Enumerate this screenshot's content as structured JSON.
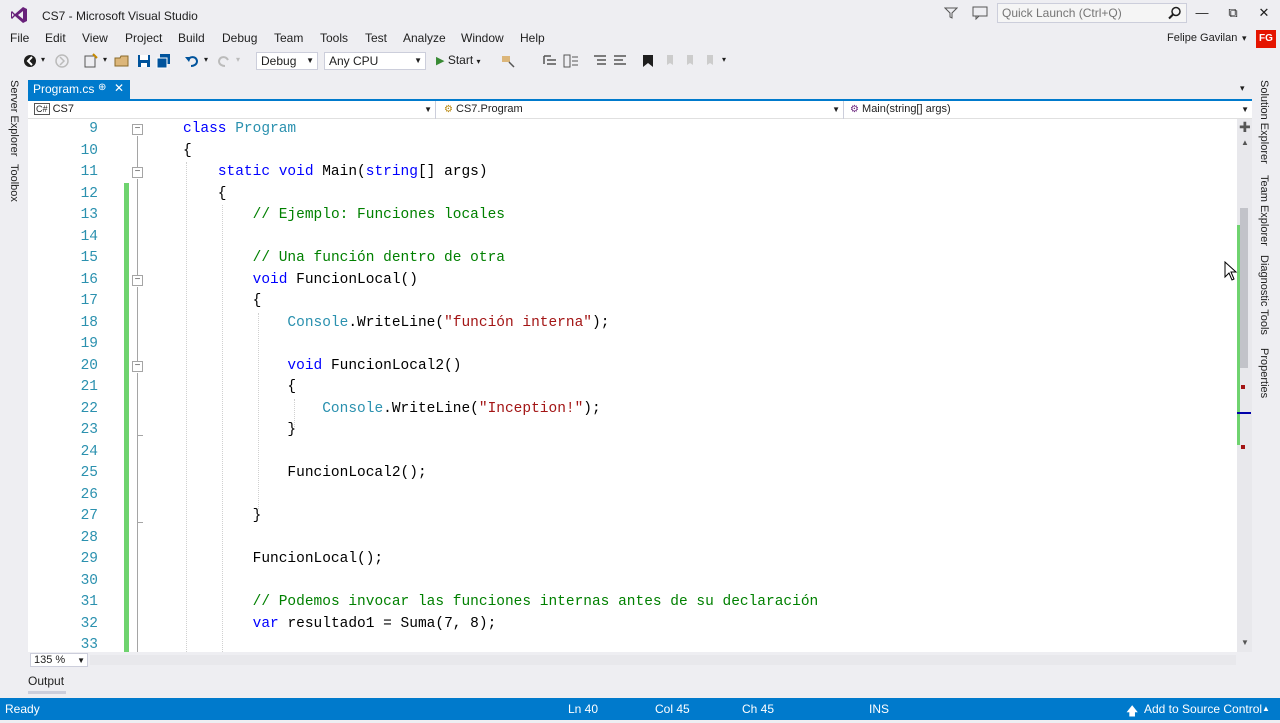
{
  "window": {
    "title": "CS7 - Microsoft Visual Studio",
    "quick_launch_placeholder": "Quick Launch (Ctrl+Q)",
    "user_name": "Felipe Gavilan",
    "user_initials": "FG",
    "minimize": "—",
    "maximize": "⧉",
    "close": "✕"
  },
  "menu": [
    "File",
    "Edit",
    "View",
    "Project",
    "Build",
    "Debug",
    "Team",
    "Tools",
    "Test",
    "Analyze",
    "Window",
    "Help"
  ],
  "toolbar": {
    "configuration": "Debug",
    "platform": "Any CPU",
    "start_label": "Start"
  },
  "left_tools": [
    "Server Explorer",
    "Toolbox"
  ],
  "right_tools": [
    "Solution Explorer",
    "Team Explorer",
    "Diagnostic Tools",
    "Properties"
  ],
  "document_tab": {
    "label": "Program.cs",
    "pin": "⊕",
    "close": "✕"
  },
  "navigation": {
    "project": "CS7",
    "type": "CS7.Program",
    "member": "Main(string[] args)"
  },
  "editor": {
    "line_numbers": [
      "9",
      "10",
      "11",
      "12",
      "13",
      "14",
      "15",
      "16",
      "17",
      "18",
      "19",
      "20",
      "21",
      "22",
      "23",
      "24",
      "25",
      "26",
      "27",
      "28",
      "29",
      "30",
      "31",
      "32",
      "33"
    ],
    "lines": [
      [
        {
          "c": "kw",
          "t": "class "
        },
        {
          "c": "ty",
          "t": "Program"
        }
      ],
      [
        {
          "c": "tx",
          "t": "{"
        }
      ],
      [
        {
          "c": "tx",
          "t": "    "
        },
        {
          "c": "kw",
          "t": "static void "
        },
        {
          "c": "tx",
          "t": "Main("
        },
        {
          "c": "kw",
          "t": "string"
        },
        {
          "c": "tx",
          "t": "[] args)"
        }
      ],
      [
        {
          "c": "tx",
          "t": "    {"
        }
      ],
      [
        {
          "c": "tx",
          "t": "        "
        },
        {
          "c": "cm",
          "t": "// Ejemplo: Funciones locales"
        }
      ],
      [],
      [
        {
          "c": "tx",
          "t": "        "
        },
        {
          "c": "cm",
          "t": "// Una función dentro de otra"
        }
      ],
      [
        {
          "c": "tx",
          "t": "        "
        },
        {
          "c": "kw",
          "t": "void "
        },
        {
          "c": "tx",
          "t": "FuncionLocal()"
        }
      ],
      [
        {
          "c": "tx",
          "t": "        {"
        }
      ],
      [
        {
          "c": "tx",
          "t": "            "
        },
        {
          "c": "ty",
          "t": "Console"
        },
        {
          "c": "tx",
          "t": ".WriteLine("
        },
        {
          "c": "st",
          "t": "\"función interna\""
        },
        {
          "c": "tx",
          "t": ");"
        }
      ],
      [],
      [
        {
          "c": "tx",
          "t": "            "
        },
        {
          "c": "kw",
          "t": "void "
        },
        {
          "c": "tx",
          "t": "FuncionLocal2()"
        }
      ],
      [
        {
          "c": "tx",
          "t": "            {"
        }
      ],
      [
        {
          "c": "tx",
          "t": "                "
        },
        {
          "c": "ty",
          "t": "Console"
        },
        {
          "c": "tx",
          "t": ".WriteLine("
        },
        {
          "c": "st",
          "t": "\"Inception!\""
        },
        {
          "c": "tx",
          "t": ");"
        }
      ],
      [
        {
          "c": "tx",
          "t": "            }"
        }
      ],
      [],
      [
        {
          "c": "tx",
          "t": "            FuncionLocal2();"
        }
      ],
      [],
      [
        {
          "c": "tx",
          "t": "        }"
        }
      ],
      [],
      [
        {
          "c": "tx",
          "t": "        FuncionLocal();"
        }
      ],
      [],
      [
        {
          "c": "tx",
          "t": "        "
        },
        {
          "c": "cm",
          "t": "// Podemos invocar las funciones internas antes de su declaración"
        }
      ],
      [
        {
          "c": "tx",
          "t": "        "
        },
        {
          "c": "kw",
          "t": "var "
        },
        {
          "c": "tx",
          "t": "resultado1 = Suma(7, 8);"
        }
      ],
      []
    ],
    "zoom": "135 %"
  },
  "output_tab": "Output",
  "status": {
    "ready": "Ready",
    "line": "Ln 40",
    "col": "Col 45",
    "ch": "Ch 45",
    "mode": "INS",
    "source_control": "Add to Source Control"
  },
  "colors": {
    "accent": "#007acc",
    "keyword": "#0000ff",
    "type": "#2b91af",
    "comment": "#008000",
    "string": "#a31515",
    "change_bar": "#6fd36f",
    "avatar": "#e51400"
  }
}
